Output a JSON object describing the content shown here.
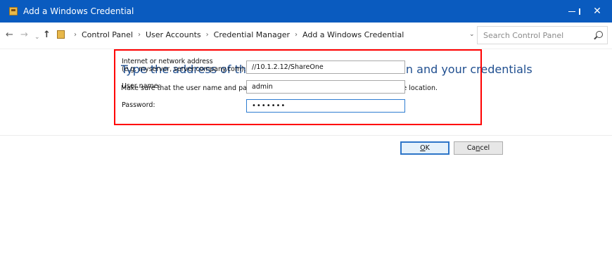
{
  "window": {
    "title": "Add a Windows Credential",
    "controls": {
      "minimize_icon": "minimize-icon",
      "maximize_icon": "maximize-icon",
      "close_icon": "close-icon"
    },
    "accent": "#0a5bbf"
  },
  "address_bar": {
    "nav_icons": [
      "back-icon",
      "forward-icon",
      "recent-locations-icon",
      "up-icon"
    ],
    "breadcrumb": [
      "Control Panel",
      "User Accounts",
      "Credential Manager",
      "Add a Windows Credential"
    ],
    "search_placeholder": "Search Control Panel"
  },
  "page": {
    "heading": "Type the address of the website or network location and your credentials",
    "instruction": "Make sure that the user name and password that you type can be used to access the location.",
    "highlight_color": "#ff0000",
    "heading_color": "#1f4e8f",
    "fields": {
      "address": {
        "label_line1": "Internet or network address",
        "label_line2": "(e.g. myserver, server.company.com):",
        "value": "//10.1.2.12/ShareOne"
      },
      "username": {
        "label": "User name:",
        "value": "admin"
      },
      "password": {
        "label": "Password:",
        "masked_value": "•••••••"
      }
    }
  },
  "buttons": {
    "ok_prefix": "",
    "ok_accel": "O",
    "ok_suffix": "K",
    "cancel_prefix": "Ca",
    "cancel_accel": "n",
    "cancel_suffix": "cel"
  }
}
